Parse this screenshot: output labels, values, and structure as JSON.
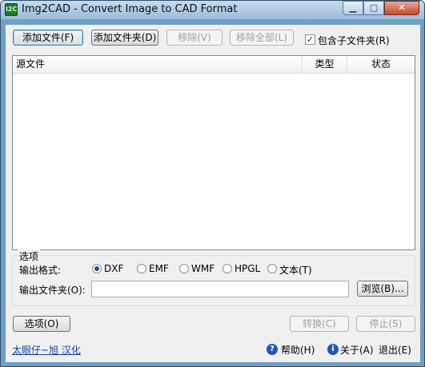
{
  "window": {
    "title": "Img2CAD - Convert Image to CAD Format",
    "icon_text": "I2C",
    "minimize_symbol": "▁",
    "maximize_symbol": "▢",
    "close_symbol": "✕"
  },
  "toolbar": {
    "add_file": "添加文件(F)",
    "add_folder": "添加文件夹(D)",
    "remove": "移除(V)",
    "remove_all": "移除全部(L)",
    "include_subfolders_label": "包含子文件夹(R)",
    "include_subfolders_checked": true,
    "checkmark": "✓"
  },
  "file_list": {
    "columns": [
      "源文件",
      "类型",
      "状态"
    ],
    "rows": []
  },
  "options": {
    "group_title": "选项",
    "format_label": "输出格式:",
    "formats": [
      {
        "label": "DXF",
        "selected": true
      },
      {
        "label": "EMF",
        "selected": false
      },
      {
        "label": "WMF",
        "selected": false
      },
      {
        "label": "HPGL",
        "selected": false
      },
      {
        "label": "文本(T)",
        "selected": false
      }
    ],
    "output_folder_label": "输出文件夹(O):",
    "output_folder_value": "",
    "browse": "浏览(B)..."
  },
  "actions": {
    "options_button": "选项(O)",
    "convert": "转换(C)",
    "stop": "停止(S)"
  },
  "footer": {
    "credit_link": "太眼仔~旭 汉化",
    "help": "帮助(H)",
    "about": "关于(A)",
    "exit": "退出(E)",
    "help_icon_glyph": "?",
    "about_icon_glyph": "i"
  }
}
